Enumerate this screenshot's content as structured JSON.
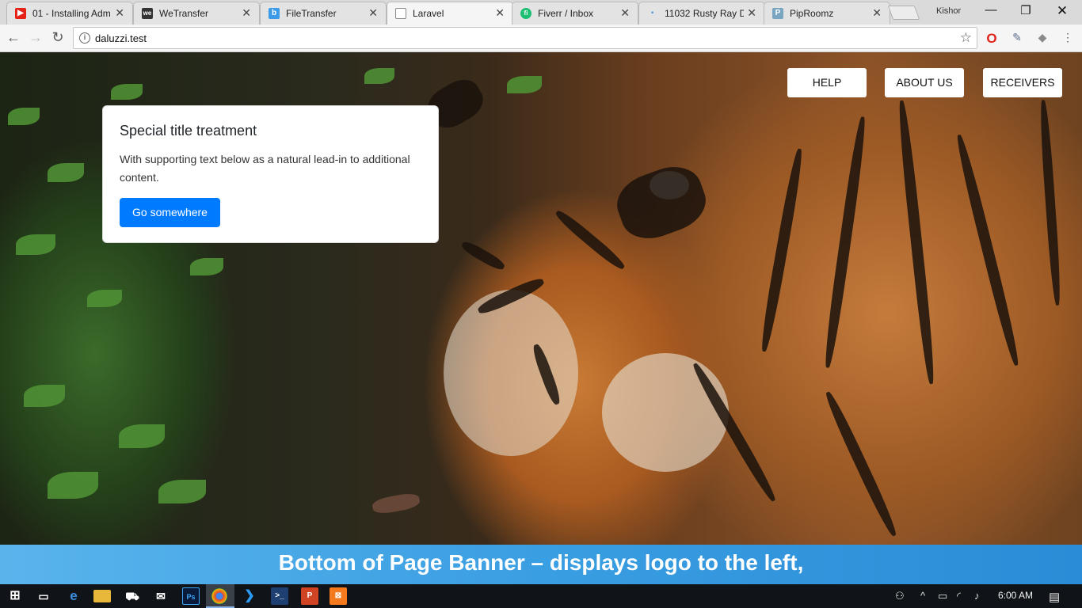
{
  "browser": {
    "tabs": [
      {
        "title": "01 - Installing Adm",
        "favicon": "youtube-icon",
        "color": "#e62117",
        "glyph": "▶"
      },
      {
        "title": "WeTransfer",
        "favicon": "wetransfer-icon",
        "color": "#333333",
        "glyph": "we"
      },
      {
        "title": "FileTransfer",
        "favicon": "filetransfer-icon",
        "color": "#3b9be8",
        "glyph": "b"
      },
      {
        "title": "Laravel",
        "favicon": "page-icon",
        "color": "#9e9e9e",
        "glyph": "▯"
      },
      {
        "title": "Fiverr / Inbox",
        "favicon": "fiverr-icon",
        "color": "#1dbf73",
        "glyph": "fi"
      },
      {
        "title": "11032 Rusty Ray D",
        "favicon": "dot-icon",
        "color": "#4a90d9",
        "glyph": "·"
      },
      {
        "title": "PipRoomz",
        "favicon": "piproomz-icon",
        "color": "#7aa6c2",
        "glyph": "P"
      }
    ],
    "active_tab_index": 3,
    "profile_name": "Kishor",
    "url": "daluzzi.test"
  },
  "page": {
    "nav": [
      "HELP",
      "ABOUT US",
      "RECEIVERS"
    ],
    "card": {
      "title": "Special title treatment",
      "text": "With supporting text below as a natural lead-in to additional content.",
      "button": "Go somewhere"
    },
    "banner": "Bottom of Page Banner – displays logo to the left,"
  },
  "taskbar": {
    "clock": "6:00 AM",
    "apps": [
      "windows-start-icon",
      "task-view-icon",
      "edge-icon",
      "file-explorer-icon",
      "store-icon",
      "mail-icon",
      "photoshop-icon",
      "chrome-icon",
      "vscode-icon",
      "powershell-icon",
      "powerpoint-icon",
      "xampp-icon"
    ]
  }
}
